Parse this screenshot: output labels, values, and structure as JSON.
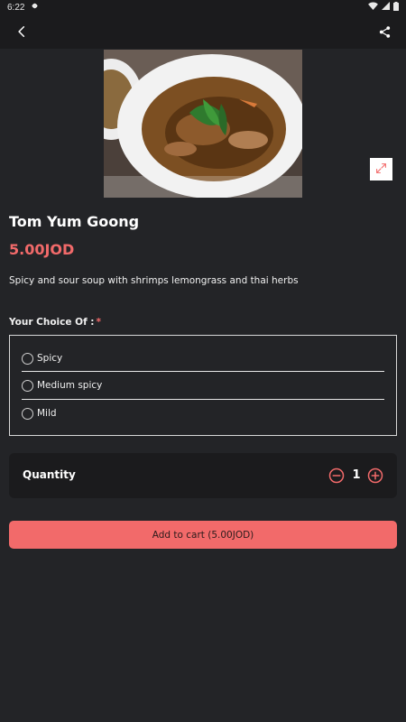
{
  "status_bar": {
    "time": "6:22"
  },
  "item": {
    "name": "Tom Yum Goong",
    "price": "5.00JOD",
    "description": "Spicy and sour soup with shrimps lemongrass and thai herbs"
  },
  "choice": {
    "title": "Your Choice Of :",
    "required_mark": "*",
    "options": [
      {
        "label": "Spicy"
      },
      {
        "label": "Medium spicy"
      },
      {
        "label": "Mild"
      }
    ]
  },
  "quantity": {
    "label": "Quantity",
    "value": "1"
  },
  "cart": {
    "button_label": "Add to cart (5.00JOD)"
  },
  "colors": {
    "accent": "#f26a6a",
    "background": "#232427",
    "surface": "#1b1b1d"
  },
  "icons": [
    "back-arrow-icon",
    "share-icon",
    "expand-icon",
    "minus-circle-icon",
    "plus-circle-icon",
    "settings-gear-icon",
    "wifi-icon",
    "signal-icon",
    "battery-icon"
  ]
}
